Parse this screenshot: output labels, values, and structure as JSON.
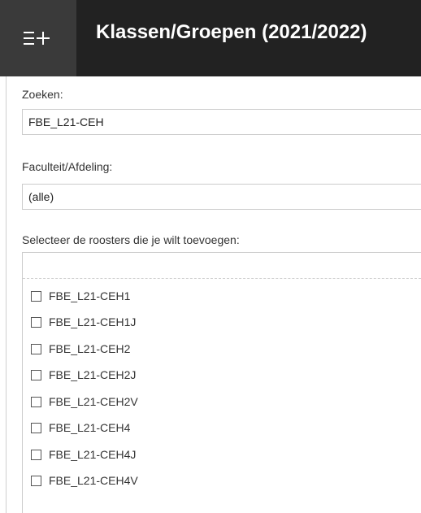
{
  "header": {
    "title": "Klassen/Groepen (2021/2022)",
    "menu_icon": "add-to-list-icon"
  },
  "search": {
    "label": "Zoeken:",
    "value": "FBE_L21-CEH"
  },
  "faculty": {
    "label": "Faculteit/Afdeling:",
    "value": "(alle)"
  },
  "schedules": {
    "label": "Selecteer de roosters die je wilt toevoegen:",
    "filter_value": "",
    "items": [
      {
        "label": "FBE_L21-CEH1",
        "checked": false
      },
      {
        "label": "FBE_L21-CEH1J",
        "checked": false
      },
      {
        "label": "FBE_L21-CEH2",
        "checked": false
      },
      {
        "label": "FBE_L21-CEH2J",
        "checked": false
      },
      {
        "label": "FBE_L21-CEH2V",
        "checked": false
      },
      {
        "label": "FBE_L21-CEH4",
        "checked": false
      },
      {
        "label": "FBE_L21-CEH4J",
        "checked": false
      },
      {
        "label": "FBE_L21-CEH4V",
        "checked": false
      }
    ]
  },
  "colors": {
    "header_bg": "#222222",
    "header_icon_bg": "#3a3a3a",
    "border": "#cccccc"
  }
}
